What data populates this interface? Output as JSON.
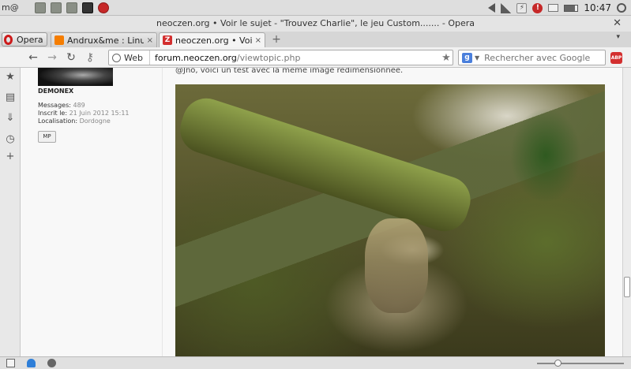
{
  "system_panel": {
    "menu_label": "m@",
    "clock": "10:47"
  },
  "window": {
    "title": "neoczen.org • Voir le sujet - \"Trouvez Charlie\", le jeu Custom....... - Opera",
    "close_glyph": "✕"
  },
  "tabs": {
    "menu_label": "Opera",
    "items": [
      {
        "label": "Andrux&me : Linu...",
        "favicon": "blogger-icon",
        "active": false
      },
      {
        "label": "neoczen.org • Voir...",
        "favicon": "neoczen-icon",
        "active": true
      }
    ],
    "close_glyph": "×",
    "new_tab_glyph": "+",
    "tab_menu_glyph": "▾"
  },
  "navigation": {
    "web_badge": "Web",
    "url_host": "forum.neoczen.org",
    "url_path": "/viewtopic.php",
    "search_placeholder": "Rechercher avec Google",
    "search_engine_letter": "g",
    "abp_label": "ABP"
  },
  "post": {
    "username": "DEMONEX",
    "messages_label": "Messages:",
    "messages_value": "489",
    "joined_label": "Inscrit le:",
    "joined_value": "21 Juin 2012 15:11",
    "location_label": "Localisation:",
    "location_value": "Dordogne",
    "pm_label": "MP",
    "body_text": "@Jno, voici un test avec la même image redimensionnée."
  },
  "colors": {
    "opera_red": "#cc1a1a",
    "panel_bg": "#dedede",
    "content_bg": "#f8f8f8"
  },
  "scroll": {
    "vertical_position": 0.78
  },
  "zoom": {
    "slider_fraction": 0.24
  }
}
